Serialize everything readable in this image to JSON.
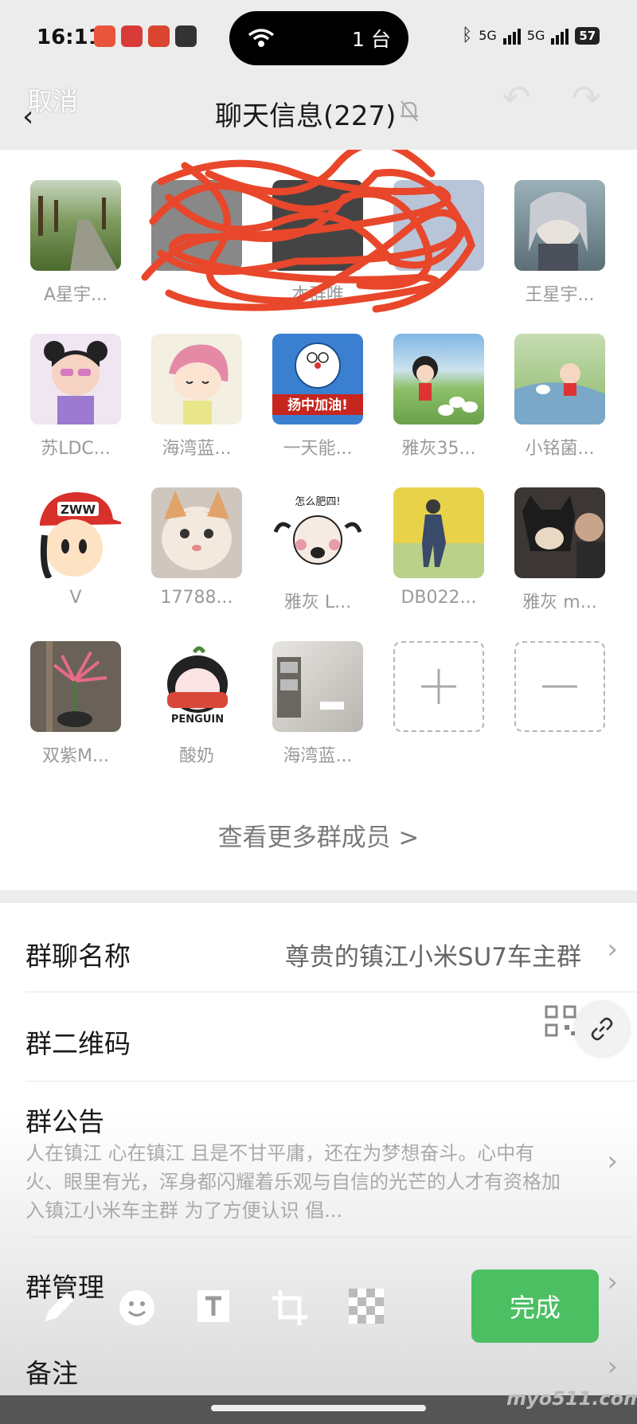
{
  "status": {
    "time": "16:11",
    "island_count": "1 台",
    "signal_1": "5G",
    "signal_2": "5G",
    "battery": "57"
  },
  "header": {
    "cancel": "取消",
    "title": "聊天信息(227)"
  },
  "members": [
    {
      "name": "A星宇...",
      "art": "path"
    },
    {
      "name": "",
      "art": "redacted"
    },
    {
      "name": "本群唯",
      "art": "redacted"
    },
    {
      "name": "",
      "art": "redacted"
    },
    {
      "name": "王星宇...",
      "art": "anime"
    },
    {
      "name": "苏LDC...",
      "art": "girl"
    },
    {
      "name": "海湾蓝...",
      "art": "girl2"
    },
    {
      "name": "一天能...",
      "art": "doraemon"
    },
    {
      "name": "雅灰35...",
      "art": "maruko"
    },
    {
      "name": "小铭菌...",
      "art": "shinchan"
    },
    {
      "name": "V",
      "art": "cap"
    },
    {
      "name": "17788...",
      "art": "cat"
    },
    {
      "name": "雅灰 L...",
      "art": "meme"
    },
    {
      "name": "DB022...",
      "art": "yellow"
    },
    {
      "name": "雅灰 m...",
      "art": "dog"
    },
    {
      "name": "双紫M...",
      "art": "flower"
    },
    {
      "name": "酸奶",
      "art": "penguin"
    },
    {
      "name": "海湾蓝...",
      "art": "photo"
    }
  ],
  "doraemon_label": "扬中加油!",
  "cap_label": "ZWW",
  "meme_label": "怎么肥四!",
  "penguin_label": "PENGUIN",
  "more_members": "查看更多群成员 >",
  "settings": {
    "group_name_label": "群聊名称",
    "group_name_value": "尊贵的镇江小米SU7车主群",
    "qr_label": "群二维码",
    "notice_label": "群公告",
    "notice_text": "人在镇江 心在镇江 且是不甘平庸，还在为梦想奋斗。心中有火、眼里有光，浑身都闪耀着乐观与自信的光芒的人才有资格加入镇江小米车主群 为了方便认识 倡...",
    "manage_label": "群管理",
    "remark_label": "备注"
  },
  "done_label": "完成",
  "watermark": "myo511.com",
  "colors": {
    "done": "#4cbf63",
    "scribble": "#e8472b"
  }
}
